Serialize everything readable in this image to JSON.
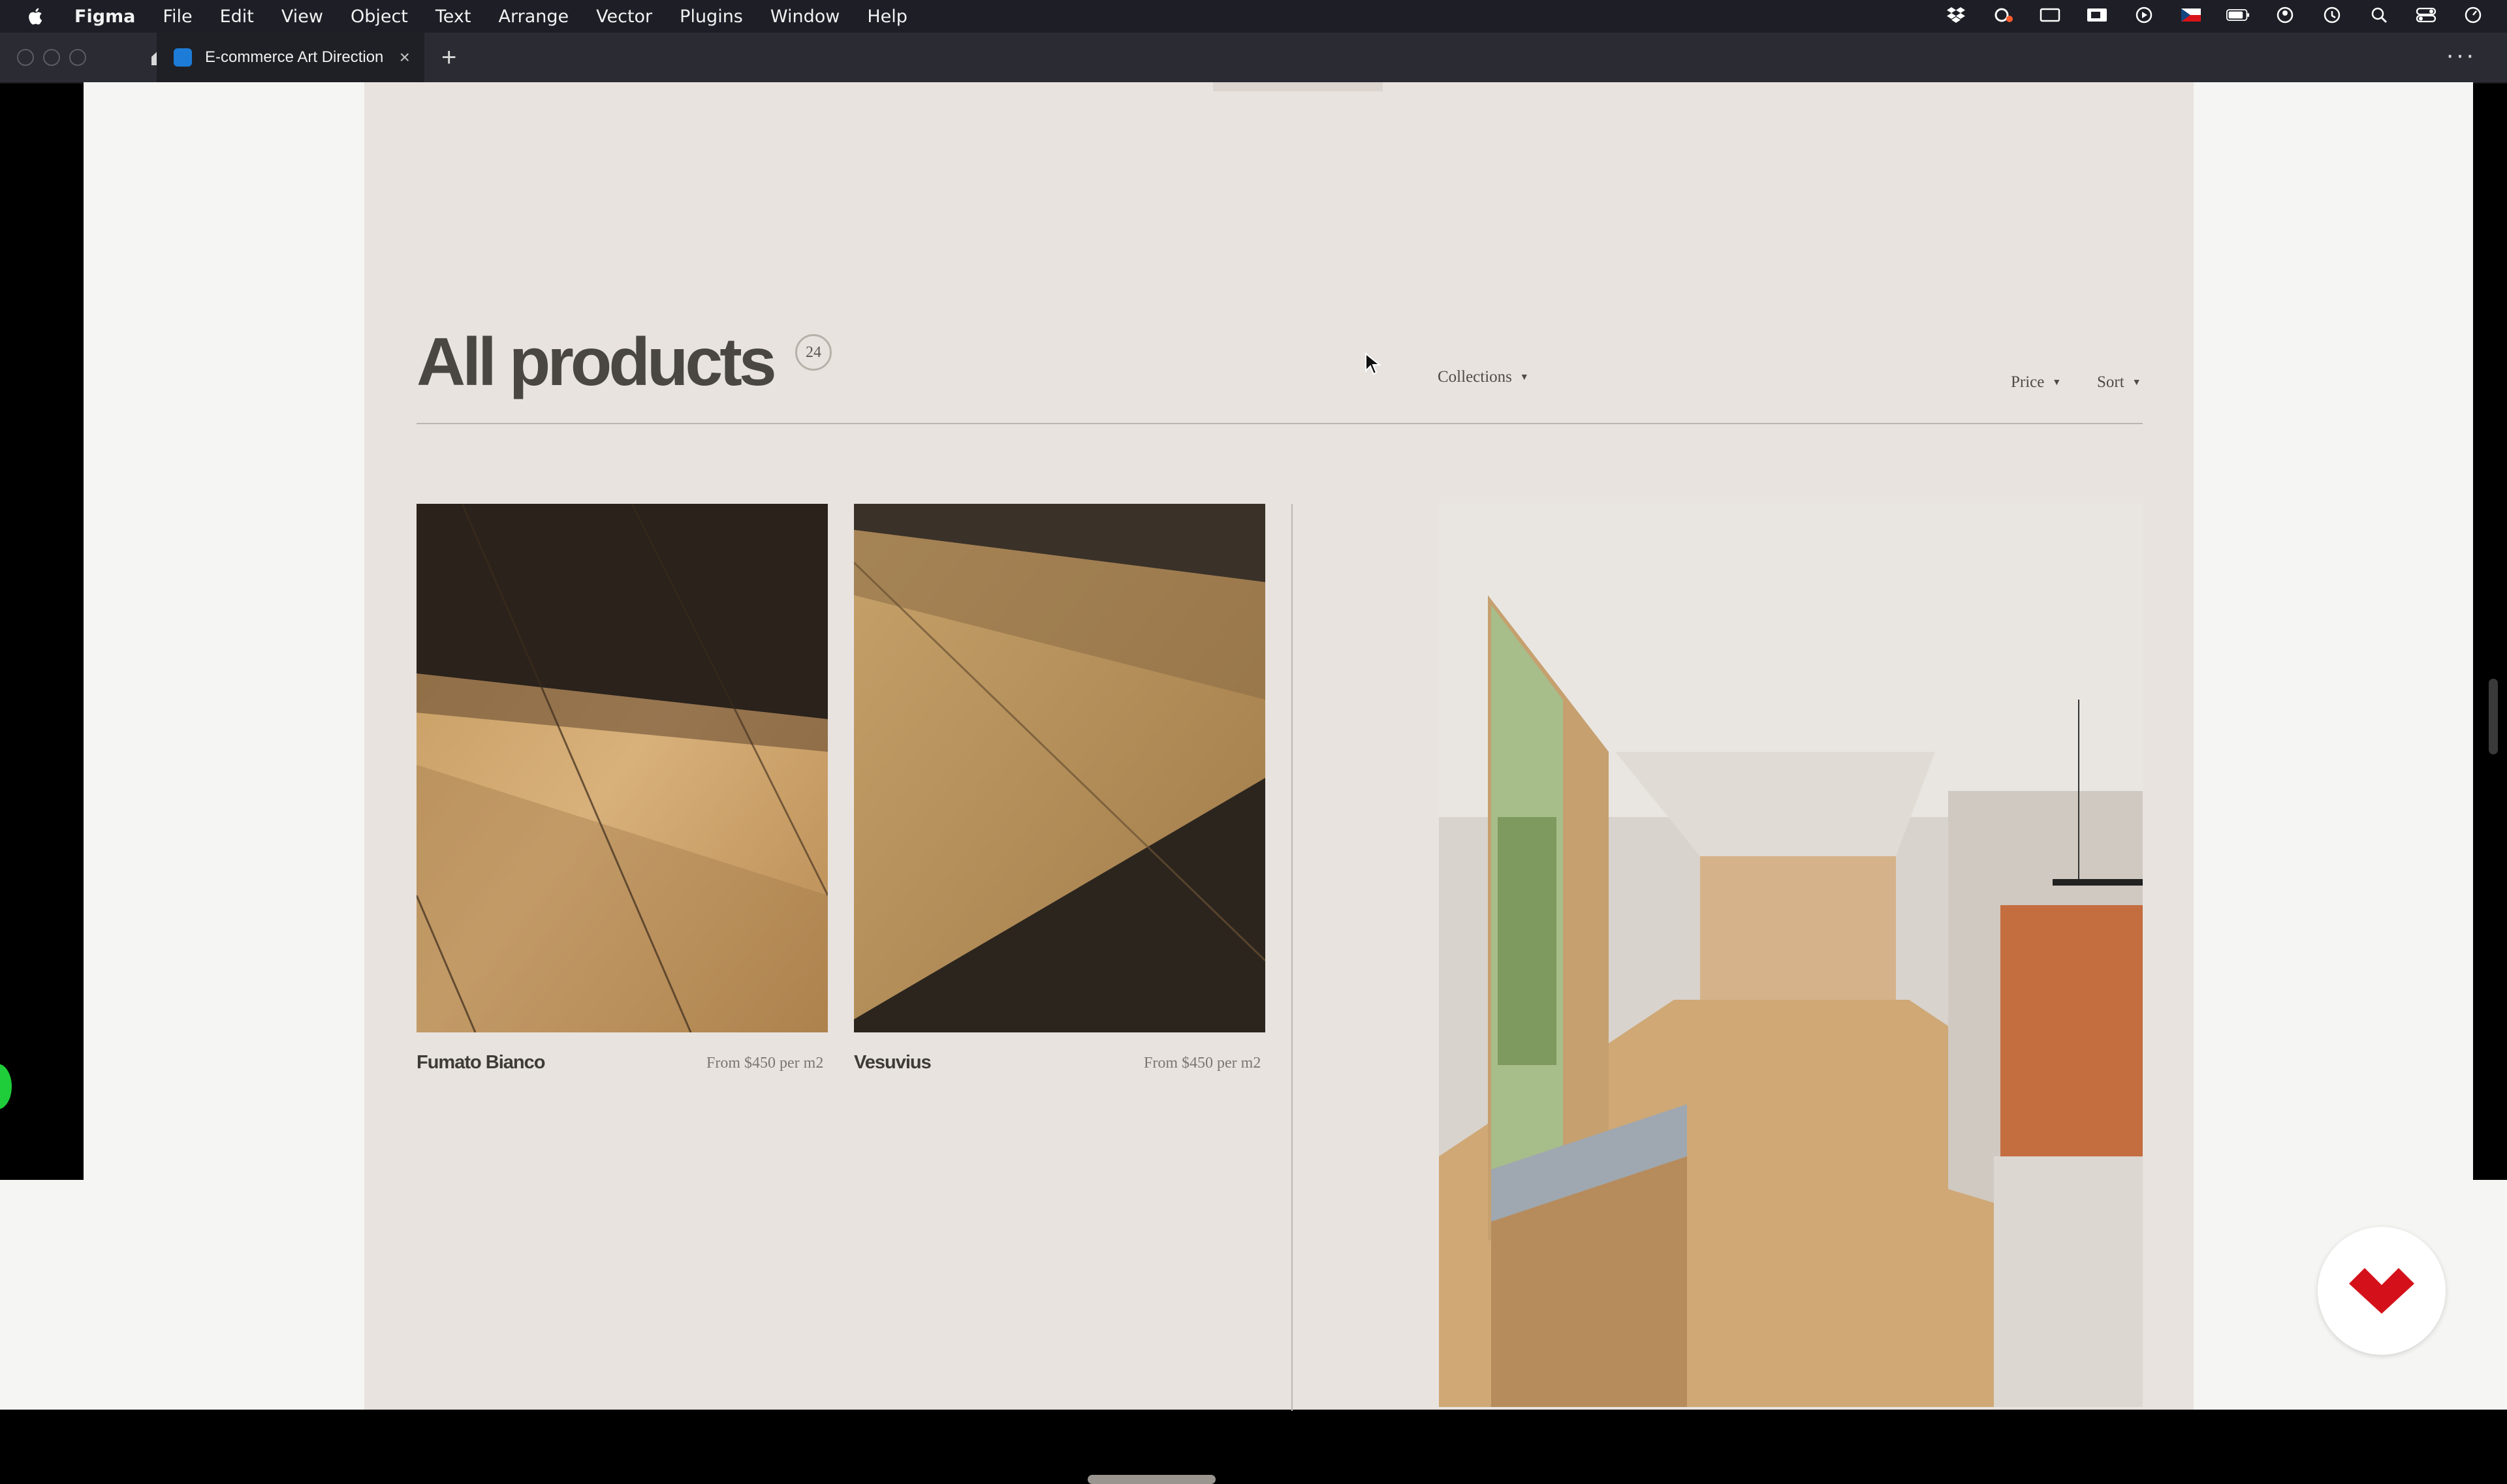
{
  "menubar": {
    "app_name": "Figma",
    "items": [
      "File",
      "Edit",
      "View",
      "Object",
      "Text",
      "Arrange",
      "Vector",
      "Plugins",
      "Window",
      "Help"
    ]
  },
  "tabs": {
    "active_title": "E-commerce Art Direction",
    "close_glyph": "×",
    "new_tab_glyph": "+",
    "more_glyph": "···"
  },
  "page": {
    "title": "All products",
    "count": "24",
    "filters": {
      "collections": "Collections",
      "price": "Price",
      "sort": "Sort"
    },
    "products": [
      {
        "name": "Fumato Bianco",
        "price": "From $450 per m2"
      },
      {
        "name": "Vesuvius",
        "price": "From $450 per m2"
      }
    ]
  },
  "colors": {
    "page_bg": "#e8e3df",
    "heading": "#4a4742",
    "badge_red": "#d4111a"
  }
}
